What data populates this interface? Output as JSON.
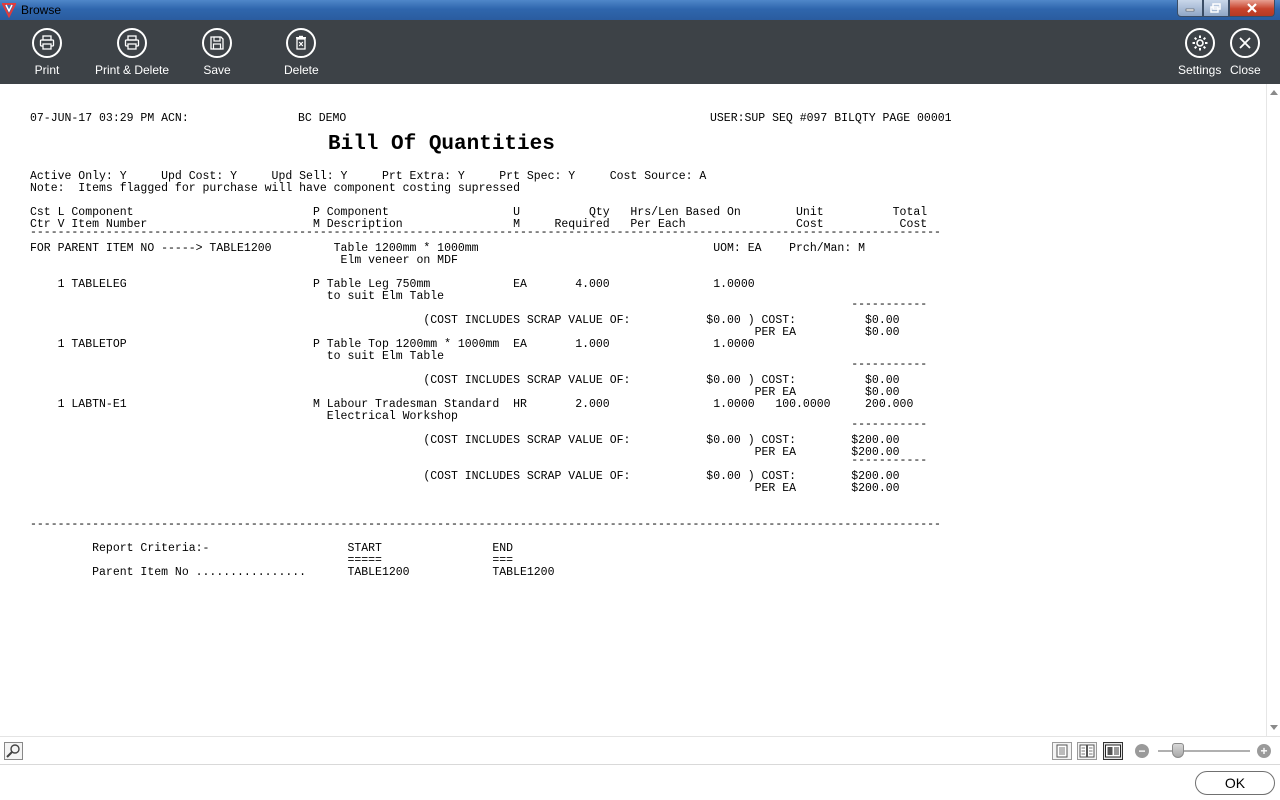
{
  "window": {
    "title": "Browse"
  },
  "toolbar": {
    "print": "Print",
    "print_delete": "Print & Delete",
    "save": "Save",
    "delete": "Delete",
    "settings": "Settings",
    "close": "Close"
  },
  "report": {
    "header_left": "07-JUN-17 03:29 PM ACN:",
    "company": "BC DEMO",
    "header_right": "USER:SUP SEQ #097 BILQTY PAGE 00001",
    "title": "Bill Of Quantities",
    "options": "Active Only: Y     Upd Cost: Y     Upd Sell: Y     Prt Extra: Y     Prt Spec: Y     Cost Source: A",
    "note": "Note:  Items flagged for purchase will have component costing supressed",
    "col_header_1": "Cst L Component                          P Component                  U          Qty   Hrs/Len Based On        Unit          Total",
    "col_header_2": "Ctr V Item Number                        M Description                M     Required   Per Each                Cost           Cost",
    "rule": "------------------------------------------------------------------------------------------------------------------------------------",
    "parent_line": "FOR PARENT ITEM NO -----> TABLE1200         Table 1200mm * 1000mm                                  UOM: EA    Prch/Man: M",
    "parent_desc": "                                             Elm veneer on MDF",
    "items": [
      {
        "line1": "    1 TABLELEG                           P Table Leg 750mm            EA       4.000               1.0000",
        "line2": "                                           to suit Elm Table",
        "underline": "                                                                                                                       -----------",
        "scrap": "                                                         (COST INCLUDES SCRAP VALUE OF:           $0.00 ) COST:          $0.00",
        "per": "                                                                                                         PER EA          $0.00"
      },
      {
        "line1": "    1 TABLETOP                           P Table Top 1200mm * 1000mm  EA       1.000               1.0000",
        "line2": "                                           to suit Elm Table",
        "underline": "                                                                                                                       -----------",
        "scrap": "                                                         (COST INCLUDES SCRAP VALUE OF:           $0.00 ) COST:          $0.00",
        "per": "                                                                                                         PER EA          $0.00"
      },
      {
        "line1": "    1 LABTN-E1                           M Labour Tradesman Standard  HR       2.000               1.0000   100.0000     200.000",
        "line2": "                                           Electrical Workshop",
        "underline": "                                                                                                                       -----------",
        "scrap": "                                                         (COST INCLUDES SCRAP VALUE OF:           $0.00 ) COST:        $200.00",
        "per": "                                                                                                         PER EA        $200.00"
      }
    ],
    "total_underline": "                                                                                                                       -----------",
    "total_scrap": "                                                         (COST INCLUDES SCRAP VALUE OF:           $0.00 ) COST:        $200.00",
    "total_per": "                                                                                                         PER EA        $200.00",
    "bottom_rule": "------------------------------------------------------------------------------------------------------------------------------------",
    "criteria_1": "         Report Criteria:-                    START                END",
    "criteria_2": "                                              =====                ===",
    "criteria_3": "         Parent Item No ................      TABLE1200            TABLE1200"
  },
  "footer": {
    "ok": "OK"
  }
}
